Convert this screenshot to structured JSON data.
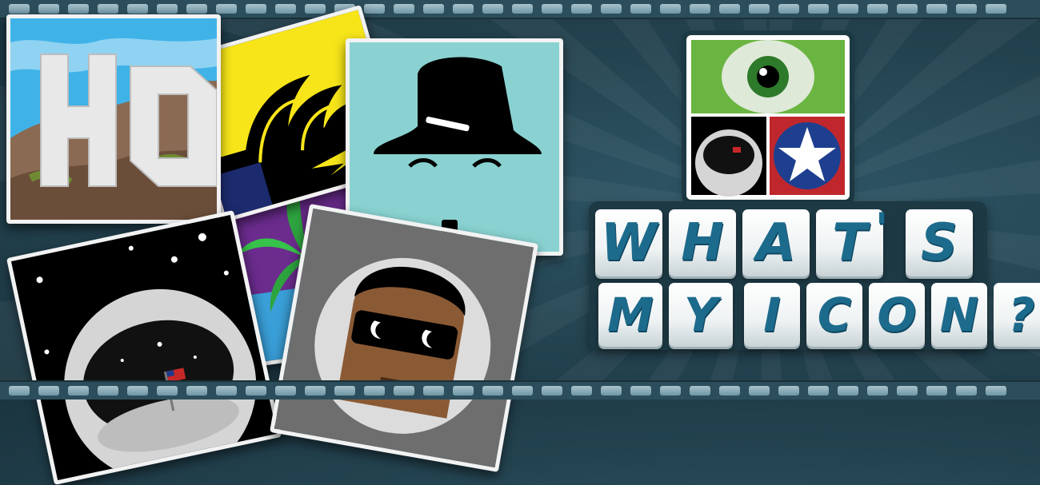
{
  "title": {
    "line1": [
      "W",
      "H",
      "A",
      "T"
    ],
    "apostrophe": "'",
    "line1_end": "S",
    "line2_word1": [
      "M",
      "Y"
    ],
    "line2_word2": [
      "I",
      "C",
      "O",
      "N",
      "?"
    ]
  },
  "icons": [
    "hollywood-sign-icon",
    "sydney-opera-house-icon",
    "charlie-chaplin-icon",
    "palm-tree-icon",
    "astronaut-icon",
    "men-in-black-agent-icon",
    "one-eyed-monster-icon",
    "captain-america-shield-icon"
  ],
  "hollywood_sign_text": "HO",
  "colors": {
    "background": "#23424f",
    "tile_letter": "#1d6b8c",
    "tile_face": "#eef2f3",
    "card_border": "#f2f2f2"
  }
}
